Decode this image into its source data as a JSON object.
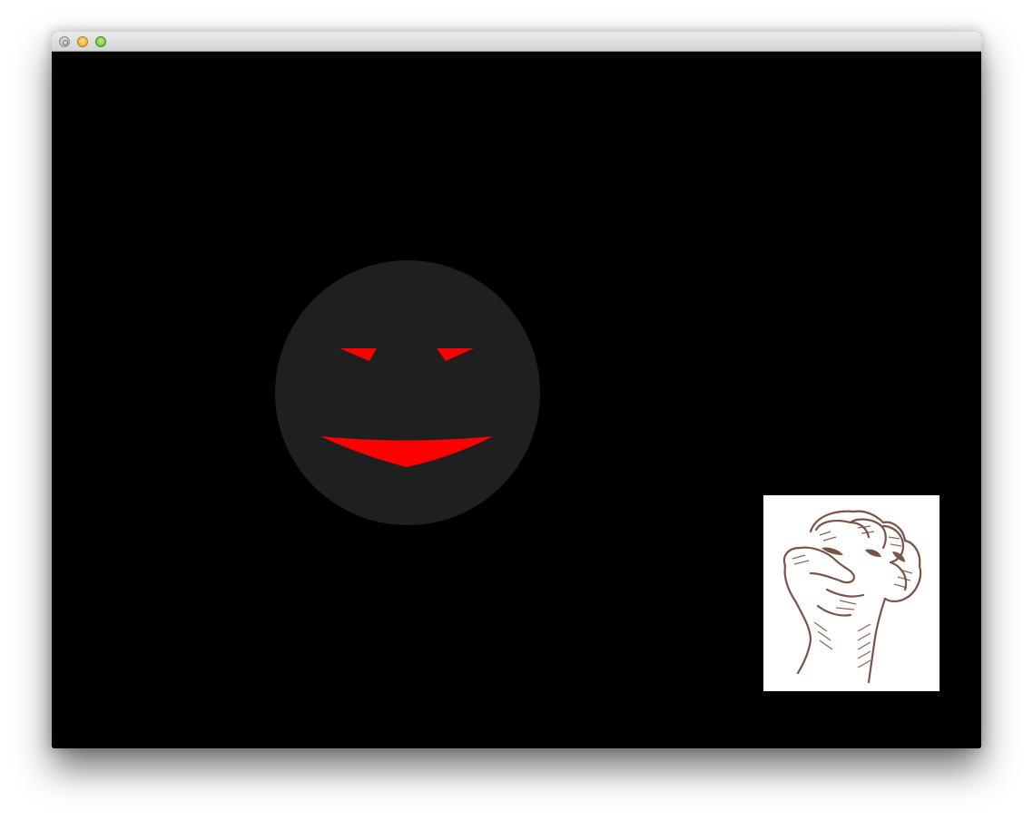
{
  "window": {
    "controls": [
      {
        "name": "close",
        "color": "#c8c8c8"
      },
      {
        "name": "minimize",
        "color": "#f5c343"
      },
      {
        "name": "maximize",
        "color": "#82d153"
      }
    ]
  },
  "game": {
    "background_color": "#000000",
    "face": {
      "color": "#1f1f1f",
      "feature_color": "#ff0000",
      "expression": "grin"
    },
    "power_up": {
      "icon": "raised-fist-icon",
      "card_color": "#ffffff",
      "ink_color": "#7a5446"
    }
  }
}
